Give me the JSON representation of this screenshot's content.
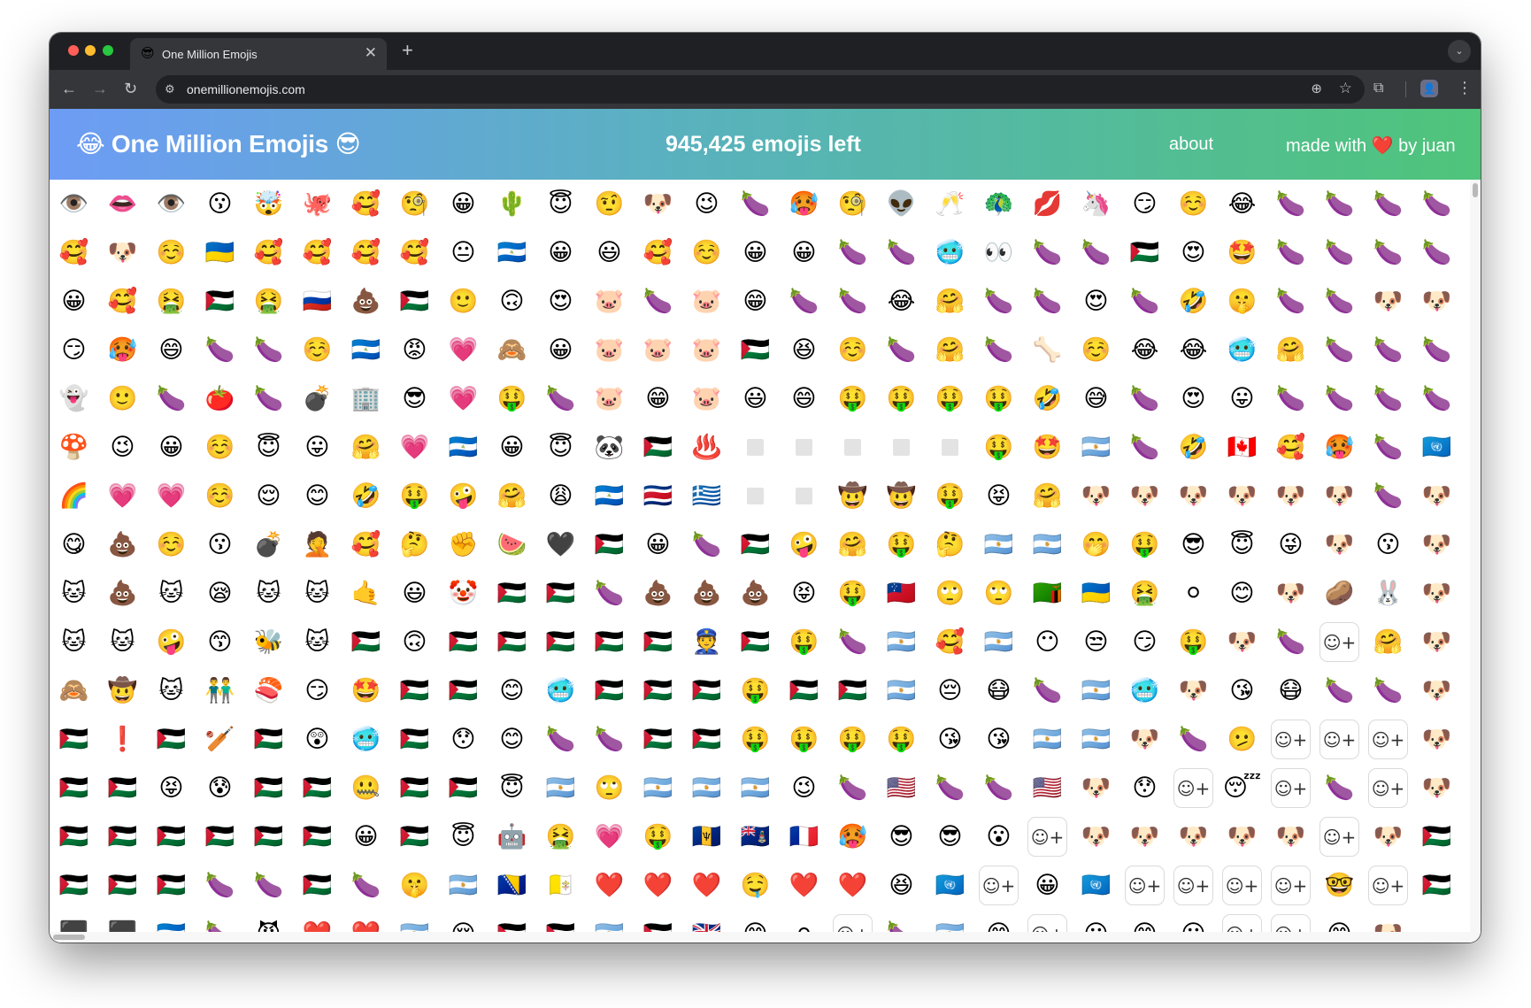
{
  "browser": {
    "tab_favicon": "😎",
    "tab_title": "One Million Emojis",
    "tab_close": "✕",
    "new_tab": "+",
    "tab_search_icon": "⌄",
    "url": "onemillionemojis.com",
    "nav": {
      "back": "←",
      "forward": "→",
      "reload": "↻"
    },
    "icons": {
      "site_info": "⚙",
      "zoom": "⊕",
      "bookmark": "☆",
      "extensions": "⧉",
      "profile": "👤",
      "menu": "⋮"
    }
  },
  "site": {
    "title": "😂 One Million Emojis 😎",
    "counter": "945,425 emojis left",
    "about": "about",
    "credits": "made with ❤️ by juan"
  },
  "grid": {
    "columns": 29,
    "empty_token": "□",
    "add_token": "+",
    "rows": [
      [
        "👁️",
        "👄",
        "👁️",
        "😗",
        "🤯",
        "🐙",
        "🥰",
        "🧐",
        "😀",
        "🌵",
        "😇",
        "🤨",
        "🐶",
        "😉",
        "🍆",
        "🥵",
        "🧐",
        "👽",
        "🥂",
        "🦚",
        "💋",
        "🦄",
        "😏",
        "☺️",
        "😂",
        "🍆",
        "🍆",
        "🍆",
        "🍆"
      ],
      [
        "🥰",
        "🐶",
        "☺️",
        "🇺🇦",
        "🥰",
        "🥰",
        "🥰",
        "🥰",
        "😐",
        "🇳🇮",
        "😀",
        "😃",
        "🥰",
        "☺️",
        "😀",
        "😀",
        "🍆",
        "🍆",
        "🥶",
        "👀",
        "🍆",
        "🍆",
        "🇵🇸",
        "😍",
        "🤩",
        "🍆",
        "🍆",
        "🍆",
        "🍆"
      ],
      [
        "😀",
        "🥰",
        "🤮",
        "🇵🇸",
        "🤮",
        "🇷🇺",
        "💩",
        "🇵🇸",
        "🙂",
        "🙃",
        "😍",
        "🐷",
        "🍆",
        "🐷",
        "😁",
        "🍆",
        "🍆",
        "😂",
        "🤗",
        "🍆",
        "🍆",
        "😍",
        "🍆",
        "🤣",
        "🤫",
        "🍆",
        "🍆",
        "🐶",
        "🐶"
      ],
      [
        "😏",
        "🥵",
        "😄",
        "🍆",
        "🍆",
        "☺️",
        "🇳🇮",
        "😡",
        "💗",
        "🙈",
        "😀",
        "🐷",
        "🐷",
        "🐷",
        "🇵🇸",
        "😆",
        "☺️",
        "🍆",
        "🤗",
        "🍆",
        "🦴",
        "☺️",
        "😂",
        "😂",
        "🥶",
        "🤗",
        "🍆",
        "🍆",
        "🍆"
      ],
      [
        "👻",
        "🙂",
        "🍆",
        "🍅",
        "🍆",
        "💣",
        "🏢",
        "😎",
        "💗",
        "🤑",
        "🍆",
        "🐷",
        "😁",
        "🐷",
        "😃",
        "😄",
        "🤑",
        "🤑",
        "🤑",
        "🤑",
        "🤣",
        "😅",
        "🍆",
        "😍",
        "😛",
        "🍆",
        "🍆",
        "🍆",
        "🍆"
      ],
      [
        "🍄",
        "😉",
        "😀",
        "☺️",
        "😇",
        "😛",
        "🤗",
        "💗",
        "🇳🇮",
        "😀",
        "😇",
        "🐼",
        "🇵🇸",
        "♨️",
        "□",
        "□",
        "□",
        "□",
        "□",
        "🤑",
        "🤩",
        "🇦🇷",
        "🍆",
        "🤣",
        "🇨🇦",
        "🥰",
        "🥵",
        "🍆",
        "🇺🇳"
      ],
      [
        "🌈",
        "💗",
        "💗",
        "☺️",
        "😌",
        "😊",
        "🤣",
        "🤑",
        "🤪",
        "🤗",
        "😩",
        "🇳🇮",
        "🇨🇷",
        "🇬🇷",
        "□",
        "□",
        "🤠",
        "🤠",
        "🤑",
        "😝",
        "🤗",
        "🐶",
        "🐶",
        "🐶",
        "🐶",
        "🐶",
        "🐶",
        "🍆",
        "🐶"
      ],
      [
        "😋",
        "💩",
        "☺️",
        "😗",
        "💣",
        "🤦",
        "🥰",
        "🤔",
        "✊",
        "🍉",
        "🖤",
        "🇵🇸",
        "😀",
        "🍆",
        "🇵🇸",
        "🤪",
        "🤗",
        "🤑",
        "🤔",
        "🇦🇷",
        "🇦🇷",
        "🤭",
        "🤑",
        "😎",
        "😇",
        "😜",
        "🐶",
        "😗",
        "🐶"
      ],
      [
        "🐱",
        "💩",
        "🐱",
        "😪",
        "🐱",
        "🐱",
        "🤙",
        "😃",
        "🤡",
        "🇵🇸",
        "🇵🇸",
        "🍆",
        "💩",
        "💩",
        "💩",
        "😝",
        "🤑",
        "🇼🇸",
        "🙄",
        "🙄",
        "🇿🇲",
        "🇺🇦",
        "🤮",
        "⚪",
        "😊",
        "🐶",
        "🥔",
        "🐰",
        "🐶"
      ],
      [
        "🐱",
        "🐱",
        "🤪",
        "😙",
        "🐝",
        "🐱",
        "🇵🇸",
        "🙃",
        "🇵🇸",
        "🇵🇸",
        "🇵🇸",
        "🇵🇸",
        "🇵🇸",
        "👮",
        "🇵🇸",
        "🤑",
        "🍆",
        "🇦🇷",
        "🥰",
        "🇦🇷",
        "😶",
        "😒",
        "😏",
        "🤑",
        "🐶",
        "🍆",
        "+",
        "🤗",
        "🐶"
      ],
      [
        "🙈",
        "🤠",
        "🐱",
        "👬",
        "🍣",
        "😏",
        "🤩",
        "🇵🇸",
        "🇵🇸",
        "😊",
        "🥶",
        "🇵🇸",
        "🇵🇸",
        "🇵🇸",
        "🤑",
        "🇵🇸",
        "🇵🇸",
        "🇦🇷",
        "😔",
        "😷",
        "🍆",
        "🇦🇷",
        "🥶",
        "🐶",
        "😘",
        "😷",
        "🍆",
        "🍆",
        "🐶"
      ],
      [
        "🇵🇸",
        "❗",
        "🇵🇸",
        "🏏",
        "🇵🇸",
        "😲",
        "🥶",
        "🇵🇸",
        "😯",
        "😊",
        "🍆",
        "🍆",
        "🇵🇸",
        "🇵🇸",
        "🤑",
        "🤑",
        "🤑",
        "🤑",
        "😘",
        "😘",
        "🇦🇷",
        "🇦🇷",
        "🐶",
        "🍆",
        "🫤",
        "+",
        "+",
        "+",
        "🐶"
      ],
      [
        "🇵🇸",
        "🇵🇸",
        "😝",
        "😰",
        "🇵🇸",
        "🇵🇸",
        "🤐",
        "🇵🇸",
        "🇵🇸",
        "😇",
        "🇦🇷",
        "🙄",
        "🇦🇷",
        "🇦🇷",
        "🇦🇷",
        "😉",
        "🍆",
        "🇺🇸",
        "🍆",
        "🍆",
        "🇺🇸",
        "🐶",
        "😯",
        "+",
        "😴",
        "+",
        "🍆",
        "+",
        "🐶"
      ],
      [
        "🇵🇸",
        "🇵🇸",
        "🇵🇸",
        "🇵🇸",
        "🇵🇸",
        "🇵🇸",
        "😀",
        "🇵🇸",
        "😇",
        "🤖",
        "🤮",
        "💗",
        "🤑",
        "🇧🇧",
        "🇰🇾",
        "🇫🇷",
        "🥵",
        "😎",
        "😎",
        "😮",
        "+",
        "🐶",
        "🐶",
        "🐶",
        "🐶",
        "🐶",
        "+",
        "🐶"
      ],
      [
        "🇵🇸",
        "🇵🇸",
        "🇵🇸",
        "🇵🇸",
        "🍆",
        "🍆",
        "🇵🇸",
        "🍆",
        "🤫",
        "🇦🇷",
        "🇧🇦",
        "🇻🇦",
        "❤️",
        "❤️",
        "❤️",
        "🤤",
        "❤️",
        "❤️",
        "😆",
        "🇺🇳",
        "+",
        "😀",
        "🇺🇳",
        "+",
        "+",
        "+",
        "+",
        "🤓",
        "+"
      ],
      [
        "🇵🇸",
        "⬛",
        "⬛",
        "🇳🇮",
        "🍆",
        "😈",
        "❤️",
        "❤️",
        "🇦🇷",
        "😌",
        "🇵🇸",
        "🇵🇸",
        "🇦🇷",
        "🇵🇸",
        "🇬🇧",
        "😊",
        "⚪",
        "+",
        "🍆",
        "🇦🇷",
        "😊",
        "+",
        "😐",
        "😊",
        "😐",
        "+",
        "+",
        "😊",
        "🐶"
      ]
    ]
  }
}
